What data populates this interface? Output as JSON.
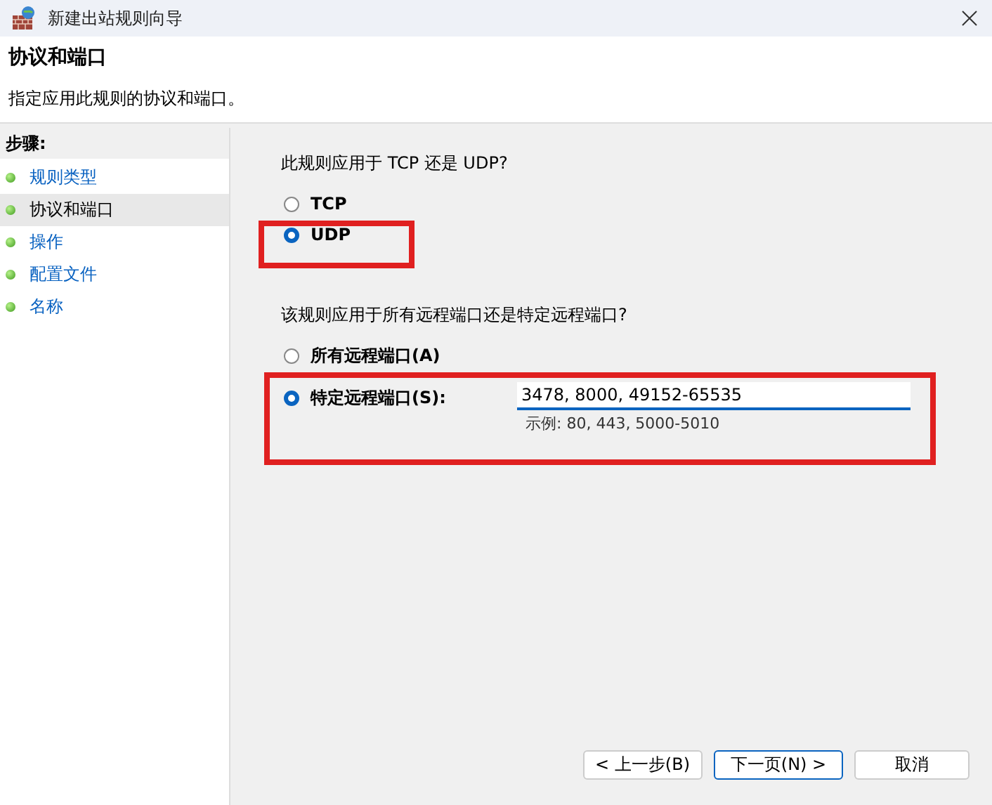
{
  "window": {
    "title": "新建出站规则向导"
  },
  "header": {
    "title": "协议和端口",
    "subtitle": "指定应用此规则的协议和端口。"
  },
  "steps": {
    "heading": "步骤:",
    "items": [
      {
        "label": "规则类型",
        "selected": false
      },
      {
        "label": "协议和端口",
        "selected": true
      },
      {
        "label": "操作",
        "selected": false
      },
      {
        "label": "配置文件",
        "selected": false
      },
      {
        "label": "名称",
        "selected": false
      }
    ]
  },
  "protocol": {
    "highlighted": true,
    "question": "此规则应用于 TCP 还是 UDP?",
    "options": [
      {
        "label": "TCP",
        "selected": false
      },
      {
        "label": "UDP",
        "selected": true
      }
    ]
  },
  "ports": {
    "highlighted": true,
    "question": "该规则应用于所有远程端口还是特定远程端口?",
    "options": [
      {
        "label": "所有远程端口(A)",
        "selected": false
      },
      {
        "label": "特定远程端口(S):",
        "selected": true
      }
    ],
    "value": "3478, 8000, 49152-65535",
    "example": "示例: 80, 443, 5000-5010"
  },
  "buttons": [
    {
      "label": "< 上一步(B)",
      "default": false
    },
    {
      "label": "下一页(N) >",
      "default": true
    },
    {
      "label": "取消",
      "default": false
    }
  ]
}
